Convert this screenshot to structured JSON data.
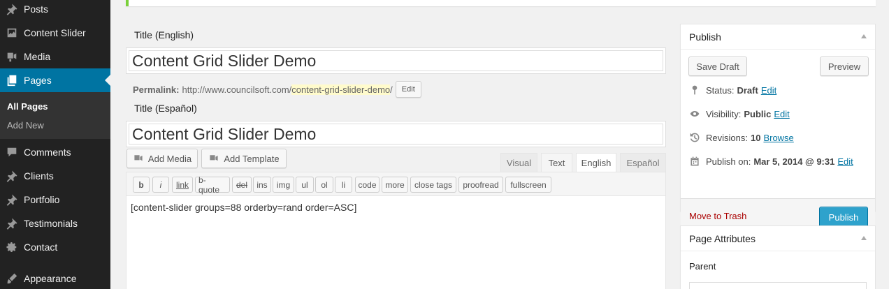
{
  "sidebar": {
    "items": [
      {
        "label": "Posts",
        "icon": "pin-icon"
      },
      {
        "label": "Content Slider",
        "icon": "gallery-icon"
      },
      {
        "label": "Media",
        "icon": "media-icon"
      },
      {
        "label": "Pages",
        "icon": "page-icon",
        "active": true
      },
      {
        "label": "Comments",
        "icon": "comment-icon"
      },
      {
        "label": "Clients",
        "icon": "pin-icon"
      },
      {
        "label": "Portfolio",
        "icon": "pin-icon"
      },
      {
        "label": "Testimonials",
        "icon": "pin-icon"
      },
      {
        "label": "Contact",
        "icon": "gear-icon"
      },
      {
        "label": "Appearance",
        "icon": "brush-icon"
      }
    ],
    "submenu": [
      {
        "label": "All Pages",
        "current": true
      },
      {
        "label": "Add New"
      }
    ]
  },
  "editor": {
    "title_en_label": "Title (English)",
    "title_en_value": "Content Grid Slider Demo",
    "permalink_label": "Permalink:",
    "permalink_base": "http://www.councilsoft.com/",
    "permalink_slug": "content-grid-slider-demo",
    "permalink_trailing": "/",
    "permalink_edit": "Edit",
    "title_es_label": "Title (Español)",
    "title_es_value": "Content Grid Slider Demo",
    "add_media": "Add Media",
    "add_template": "Add Template",
    "tabs": [
      "Visual",
      "Text",
      "English",
      "Español"
    ],
    "quicktags": [
      "b",
      "i",
      "link",
      "b-quote",
      "del",
      "ins",
      "img",
      "ul",
      "ol",
      "li",
      "code",
      "more",
      "close tags",
      "proofread",
      "fullscreen"
    ],
    "content": "[content-slider groups=88 orderby=rand order=ASC]"
  },
  "publish": {
    "title": "Publish",
    "save_draft": "Save Draft",
    "preview": "Preview",
    "status_label": "Status:",
    "status_value": "Draft",
    "status_edit": "Edit",
    "visibility_label": "Visibility:",
    "visibility_value": "Public",
    "visibility_edit": "Edit",
    "revisions_label": "Revisions:",
    "revisions_value": "10",
    "revisions_browse": "Browse",
    "publish_on_label": "Publish on:",
    "publish_on_value": "Mar 5, 2014 @ 9:31",
    "publish_on_edit": "Edit",
    "trash": "Move to Trash",
    "publish_button": "Publish"
  },
  "page_attributes": {
    "title": "Page Attributes",
    "parent_label": "Parent"
  },
  "colors": {
    "sidebar_bg": "#222222",
    "active_menu": "#0074a2",
    "notice_border": "#7ad03a",
    "publish_btn": "#2ea2cc",
    "slug_highlight": "#fffbcc",
    "trash_link": "#aa0000"
  }
}
